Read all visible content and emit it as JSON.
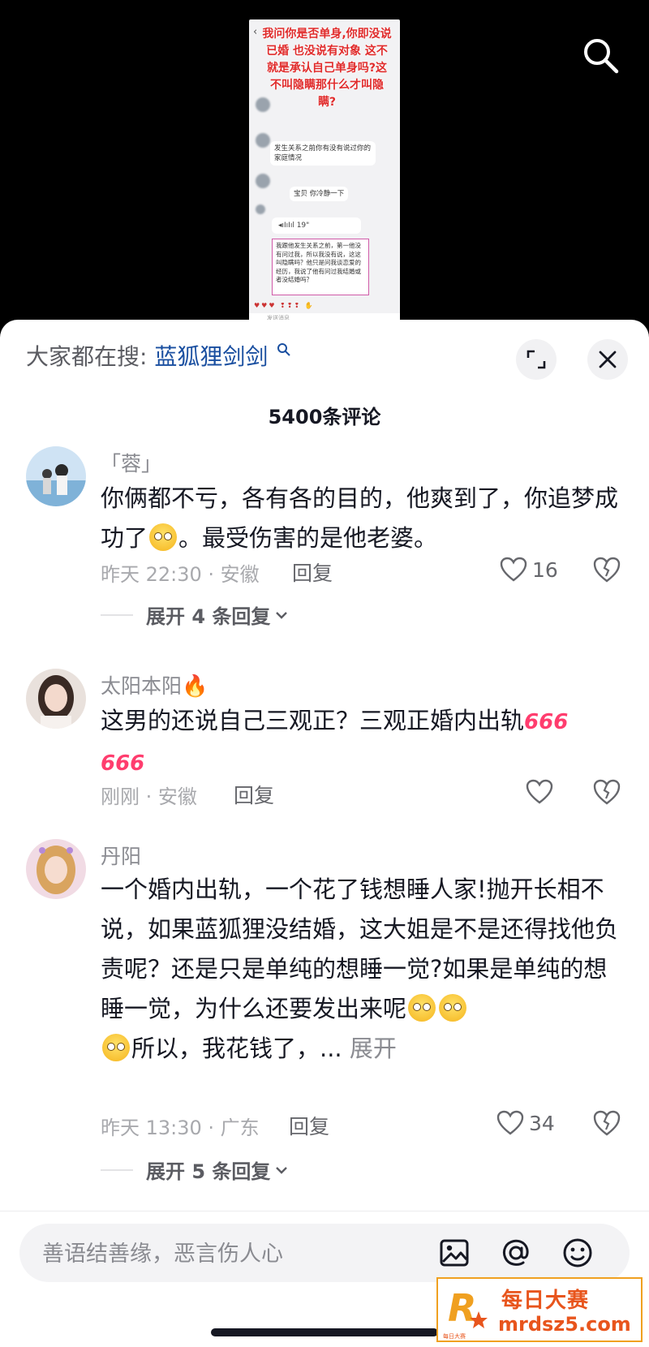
{
  "video": {
    "overlay_text": "我问你是否单身,你即没说已婚 也没说有对象 这不就是承认自己单身吗?这不叫隐瞒那什么才叫隐瞒?",
    "chat": {
      "msg1": "发生关系之前你有没有说过你的家庭情况",
      "msg2": "宝贝 你冷静一下",
      "voice_duration": "19\"",
      "boxed_msg": "我跟他发生关系之前，第一他没有问过我，所以我没有说，这这叫隐瞒吗？他只是问我谈恋爱的经历，我说了他有问过我结婚或者没结婚吗？",
      "input_placeholder": "发送消息"
    }
  },
  "header": {
    "hot_search_prefix": "大家都在搜:",
    "hot_search_keyword": "蓝狐狸剑剑",
    "comment_count": "5400条评论"
  },
  "comments": [
    {
      "username": "「蓉」",
      "text_before_emoji": "你俩都不亏，各有各的目的，他爽到了，你追梦成功了",
      "text_after_emoji": "。最受伤害的是他老婆。",
      "time_location": "昨天 22:30 · 安徽",
      "reply_label": "回复",
      "likes": "16",
      "expand_label": "展开 4 条回复"
    },
    {
      "username": "太阳本阳",
      "text": "这男的还说自己三观正？三观正婚内出轨",
      "tag1": "666",
      "tag2": "666",
      "time_location": "刚刚 · 安徽",
      "reply_label": "回复",
      "likes": ""
    },
    {
      "username": "丹阳",
      "text_main": "一个婚内出轨，一个花了钱想睡人家!抛开长相不说，如果蓝狐狸没结婚，这大姐是不是还得找他负责呢？还是只是单纯的想睡一觉?如果是单纯的想睡一觉，为什么还要发出来呢",
      "text_tail": "所以，我花钱了，...",
      "more_label": "展开",
      "time_location": "昨天 13:30 · 广东",
      "reply_label": "回复",
      "likes": "34",
      "expand_label": "展开 5 条回复"
    }
  ],
  "input": {
    "placeholder": "善语结善缘，恶言伤人心"
  },
  "watermark": {
    "title": "每日大赛",
    "url": "mrdsz5.com",
    "logo_letter": "R",
    "small": "每日大赛"
  }
}
